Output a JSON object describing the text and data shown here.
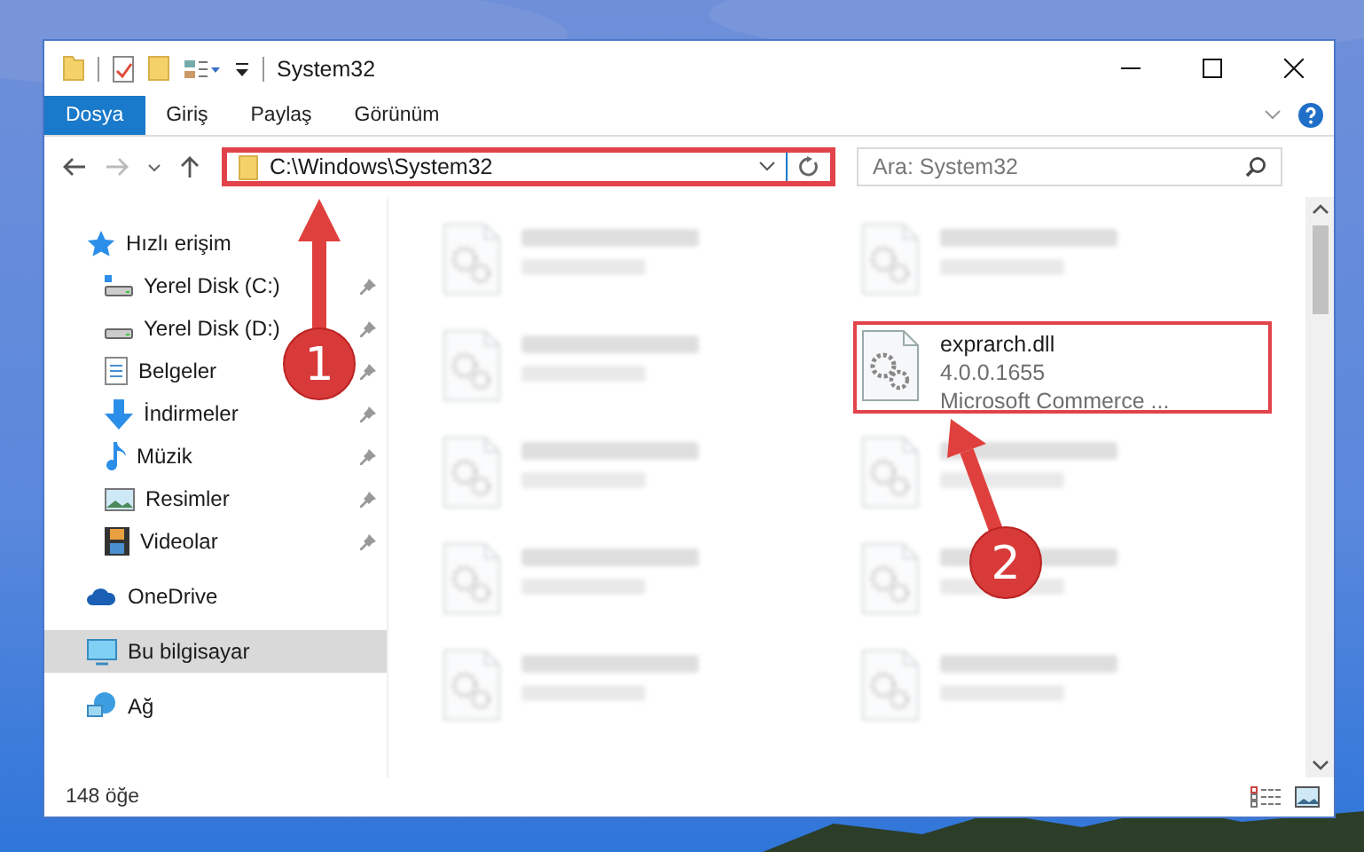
{
  "window": {
    "title": "System32"
  },
  "ribbon_tabs": [
    {
      "label": "Dosya",
      "selected": true
    },
    {
      "label": "Giriş",
      "selected": false
    },
    {
      "label": "Paylaş",
      "selected": false
    },
    {
      "label": "Görünüm",
      "selected": false
    }
  ],
  "address_bar": {
    "path": "C:\\Windows\\System32",
    "highlighted": true
  },
  "search": {
    "placeholder": "Ara: System32"
  },
  "sidebar": {
    "items": [
      {
        "label": "Hızlı erişim",
        "selected": false,
        "children": [
          {
            "label": "Yerel Disk (C:)",
            "pinned": true,
            "selected": false
          },
          {
            "label": "Yerel Disk (D:)",
            "pinned": true,
            "selected": false
          },
          {
            "label": "Belgeler",
            "pinned": true,
            "selected": false
          },
          {
            "label": "İndirmeler",
            "pinned": true,
            "selected": false
          },
          {
            "label": "Müzik",
            "pinned": true,
            "selected": false
          },
          {
            "label": "Resimler",
            "pinned": true,
            "selected": false
          },
          {
            "label": "Videolar",
            "pinned": true,
            "selected": false
          }
        ]
      },
      {
        "label": "OneDrive",
        "selected": false
      },
      {
        "label": "Bu bilgisayar",
        "selected": true
      },
      {
        "label": "Ağ",
        "selected": false
      }
    ]
  },
  "files": [
    {
      "blurred": true,
      "highlighted": false
    },
    {
      "blurred": true,
      "highlighted": false
    },
    {
      "blurred": true,
      "highlighted": false
    },
    {
      "name": "exprarch.dll",
      "details": [
        "4.0.0.1655",
        "Microsoft Commerce ..."
      ],
      "blurred": false,
      "highlighted": true
    },
    {
      "blurred": true,
      "highlighted": false
    },
    {
      "blurred": true,
      "highlighted": false
    },
    {
      "blurred": true,
      "highlighted": false
    },
    {
      "blurred": true,
      "highlighted": false
    },
    {
      "blurred": true,
      "highlighted": false
    },
    {
      "blurred": true,
      "highlighted": false
    }
  ],
  "status_bar": {
    "item_count": "148 öğe"
  },
  "callouts": [
    {
      "number": "1"
    },
    {
      "number": "2"
    }
  ]
}
